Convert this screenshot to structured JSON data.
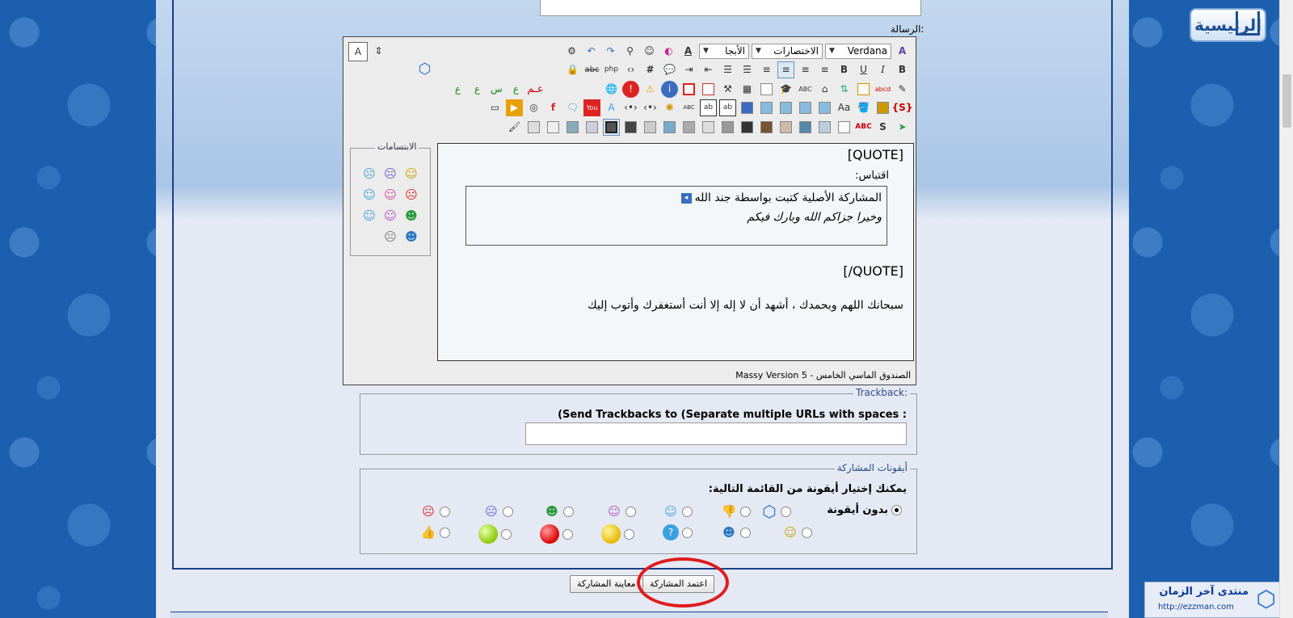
{
  "header": {
    "home_label": "الرئيسية"
  },
  "form": {
    "message_label": "الرسالة:"
  },
  "editor": {
    "font_name": "Verdana",
    "shortcuts_label": "الاختصارات",
    "abjad_label": "الأبجا",
    "smilies_title": "الابتسامات",
    "footer": "الصندوق الماسي الخامس - Massy Version 5",
    "content": {
      "quote_open": "[QUOTE]",
      "quote_label": "اقتباس:",
      "quote_origin": "المشاركة الأصلية كتبت بواسطة جند الله",
      "quote_text": "وخيرا جزاكم الله وبارك فيكم",
      "quote_close": "[/QUOTE]",
      "body": "سبحانك اللهم وبحمدك ، أشهد أن لا إله إلا أنت أستغفرك وأتوب إليك"
    }
  },
  "trackback": {
    "legend": "Trackback:",
    "label": "(Send Trackbacks to (Separate multiple URLs with spaces :",
    "value": ""
  },
  "post_icons": {
    "legend": "أيقونات المشاركة",
    "instruction": "يمكنك إختيار أيقونة من القائمة التالية:",
    "none_label": "بدون أيقونة"
  },
  "buttons": {
    "submit": "اعتمد المشاركة",
    "preview": "معاينة المشاركة"
  },
  "footer_logo": {
    "name": "منتدى آخر الزمان",
    "url": "http://ezzman.com"
  },
  "colors": {
    "accent": "#1a3e8a",
    "highlight_circle": "#e01b1b"
  }
}
